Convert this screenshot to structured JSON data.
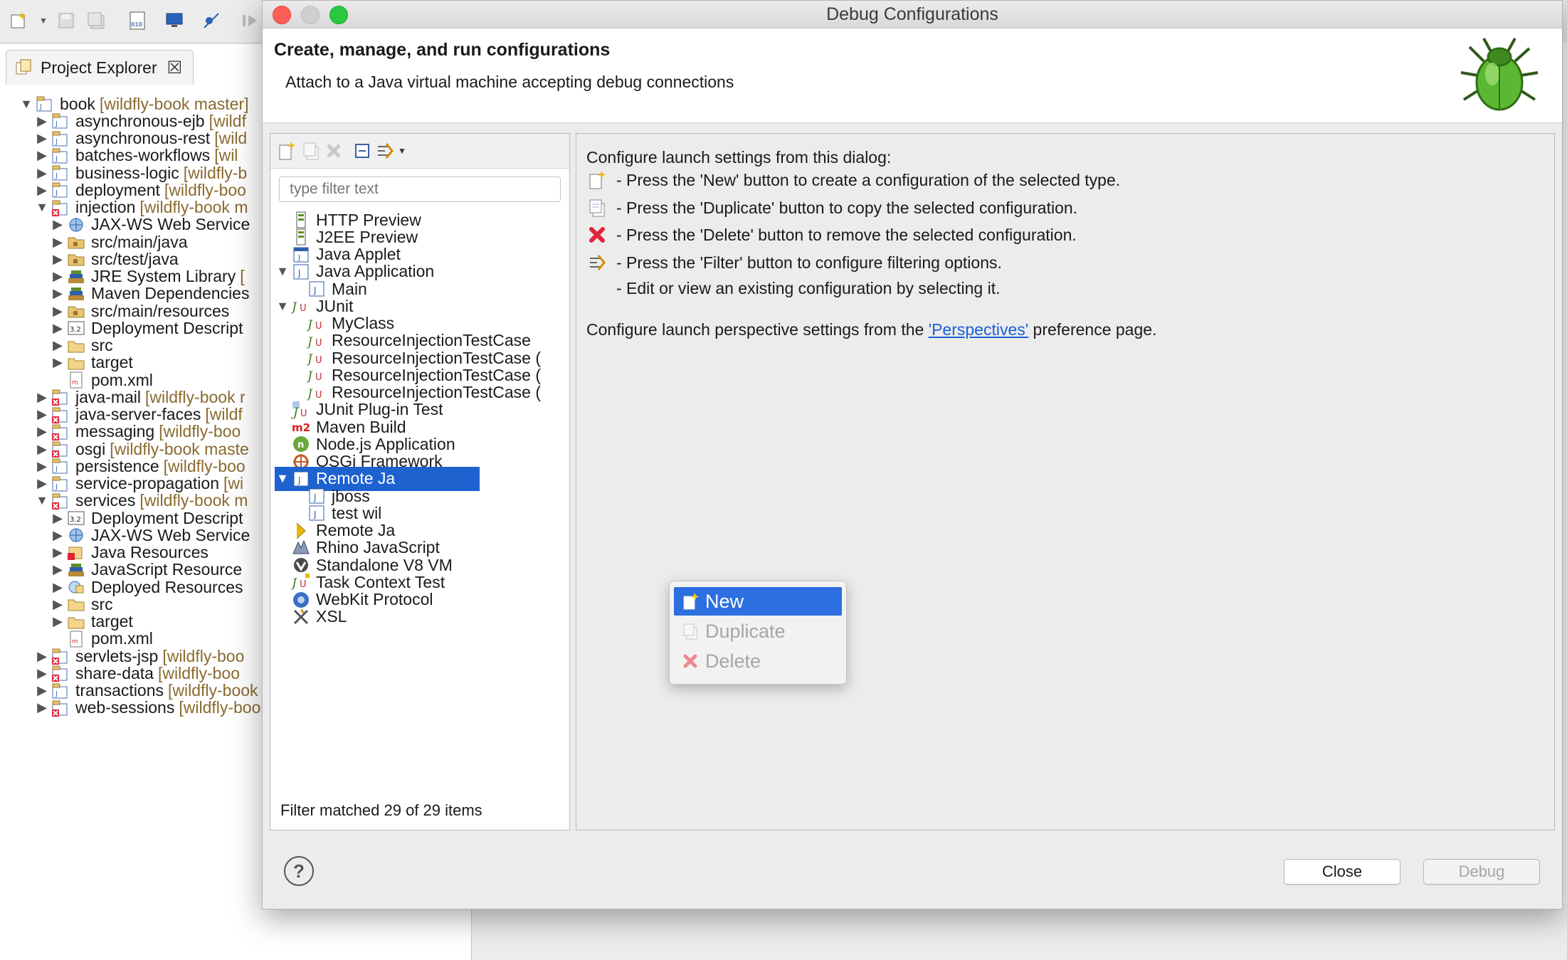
{
  "explorer": {
    "tab_label": "Project Explorer",
    "rows": [
      {
        "label": "book",
        "git": "[wildfly-book master]"
      },
      {
        "label": "asynchronous-ejb",
        "git": "[wildf"
      },
      {
        "label": "asynchronous-rest",
        "git": "[wild"
      },
      {
        "label": "batches-workflows",
        "git": "[wil"
      },
      {
        "label": "business-logic",
        "git": "[wildfly-b"
      },
      {
        "label": "deployment",
        "git": "[wildfly-boo"
      },
      {
        "label": "injection",
        "git": "[wildfly-book m"
      },
      {
        "label": "JAX-WS Web Service",
        "git": ""
      },
      {
        "label": "src/main/java",
        "git": ""
      },
      {
        "label": "src/test/java",
        "git": ""
      },
      {
        "label": "JRE System Library",
        "git": "["
      },
      {
        "label": "Maven Dependencies",
        "git": ""
      },
      {
        "label": "src/main/resources",
        "git": ""
      },
      {
        "label": "Deployment Descript",
        "git": ""
      },
      {
        "label": "src",
        "git": ""
      },
      {
        "label": "target",
        "git": ""
      },
      {
        "label": "pom.xml",
        "git": ""
      },
      {
        "label": "java-mail",
        "git": "[wildfly-book r"
      },
      {
        "label": "java-server-faces",
        "git": "[wildf"
      },
      {
        "label": "messaging",
        "git": "[wildfly-boo"
      },
      {
        "label": "osgi",
        "git": "[wildfly-book maste"
      },
      {
        "label": "persistence",
        "git": "[wildfly-boo"
      },
      {
        "label": "service-propagation",
        "git": "[wi"
      },
      {
        "label": "services",
        "git": "[wildfly-book m"
      },
      {
        "label": "Deployment Descript",
        "git": ""
      },
      {
        "label": "JAX-WS Web Service",
        "git": ""
      },
      {
        "label": "Java Resources",
        "git": ""
      },
      {
        "label": "JavaScript Resource",
        "git": ""
      },
      {
        "label": "Deployed Resources",
        "git": ""
      },
      {
        "label": "src",
        "git": ""
      },
      {
        "label": "target",
        "git": ""
      },
      {
        "label": "pom.xml",
        "git": ""
      },
      {
        "label": "servlets-jsp",
        "git": "[wildfly-boo"
      },
      {
        "label": "share-data",
        "git": "[wildfly-boo"
      },
      {
        "label": "transactions",
        "git": "[wildfly-book master]"
      },
      {
        "label": "web-sessions",
        "git": "[wildfly-book master]"
      }
    ]
  },
  "dialog": {
    "title": "Debug Configurations",
    "heading": "Create, manage, and run configurations",
    "subheading": "Attach to a Java virtual machine accepting debug connections",
    "filter_placeholder": "type filter text",
    "config_tree": [
      "HTTP Preview",
      "J2EE Preview",
      "Java Applet",
      "Java Application",
      "Main",
      "JUnit",
      "MyClass",
      "ResourceInjectionTestCase",
      "ResourceInjectionTestCase (",
      "ResourceInjectionTestCase (",
      "ResourceInjectionTestCase (",
      "JUnit Plug-in Test",
      "Maven Build",
      "Node.js Application",
      "OSGi Framework",
      "Remote Ja",
      "jboss",
      "test wil",
      "Remote Ja",
      "Rhino JavaScript",
      "Standalone V8 VM",
      "Task Context Test",
      "WebKit Protocol",
      "XSL"
    ],
    "filter_status": "Filter matched 29 of 29 items",
    "info": {
      "intro": "Configure launch settings from this dialog:",
      "new_line": "- Press the 'New' button to create a configuration of the selected type.",
      "duplicate_line": "- Press the 'Duplicate' button to copy the selected configuration.",
      "delete_line": "- Press the 'Delete' button to remove the selected configuration.",
      "filter_line": "- Press the 'Filter' button to configure filtering options.",
      "edit_line": "- Edit or view an existing configuration by selecting it.",
      "perspective_prefix": "Configure launch perspective settings from the",
      "perspective_link": "'Perspectives'",
      "perspective_suffix": "preference page."
    },
    "buttons": {
      "close": "Close",
      "debug": "Debug",
      "help": "?"
    },
    "context_menu": {
      "new": "New",
      "duplicate": "Duplicate",
      "delete": "Delete"
    }
  },
  "colors": {
    "selection": "#1e62d0",
    "menu_highlight": "#2d6fe0",
    "link": "#1a5fd6",
    "git_decoration": "#8a6a2f"
  }
}
